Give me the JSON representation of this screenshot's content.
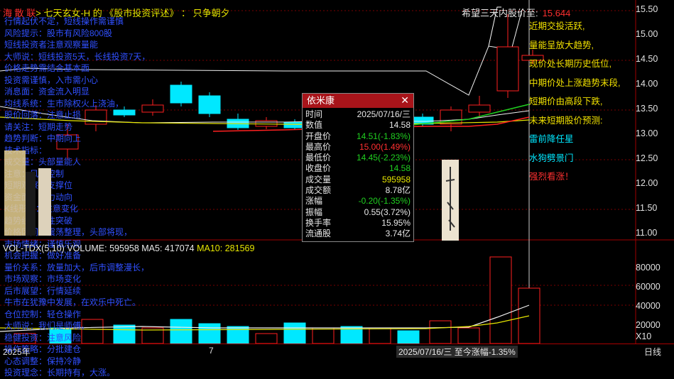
{
  "header": {
    "brand": "海 散 联",
    "text": "> 七天玄女-H  的 《股市投资评述》 ： 只争朝夕"
  },
  "forecast": {
    "label": "希望三天内股价至:",
    "value": "15.644"
  },
  "overlay_notes": [
    "行情起伏不定，短线操作需谨慎",
    "风险提示：股市有风险800股",
    "短线投资者注意观察量能",
    "大师说：短线投资5天，长线投资7天，",
    "价格走势需结合基本面",
    "投资需谨慎，入市需小心",
    "消息面：资金流入明显",
    "均线系统：生市除权火上浇油，",
    "股价回落：注意止损",
    "请关注：短期走势",
    "趋势判断：中期向上",
    "技术指标：",
    "成交量：头部量能人",
    "注意：风险控制",
    "短期观察：支撑位",
    "资金面：主力动向",
    "K线形态：注意变化",
    "趋势线：关注突破",
    "价格区间：震荡整理，头部将现，",
    "市场情绪：谨慎乐观",
    "机会把握：做好准备",
    "量价关系：放量加大，后市调整漫长，",
    "市场观察：市场变化",
    "后市展望：行情延续",
    "牛市在犹豫中发展，在欢乐中死亡。",
    "仓位控制：轻仓操作",
    "大师说：我们是师傅。",
    "稳健投资：注意风险",
    "操作策略：分批建仓",
    "心态调整：保持冷静",
    "投资理念：长期持有，大涨。"
  ],
  "commentary": [
    {
      "text": "近期交投活跃,",
      "color": "yellow"
    },
    {
      "text": "量能呈放大趋势,",
      "color": "yellow"
    },
    {
      "text": "现价处长期历史低位,",
      "color": "yellow"
    },
    {
      "text": "中期价处上涨趋势末段,",
      "color": "yellow"
    },
    {
      "text": "短期价由高段下跌,",
      "color": "yellow"
    },
    {
      "text": "未来短期股价预测:",
      "color": "yellow"
    },
    {
      "text": "雷前降任星",
      "color": "cyan"
    },
    {
      "text": "水狗劈景门",
      "color": "cyan"
    },
    {
      "text": "强烈看涨！",
      "color": "red"
    }
  ],
  "price_axis": [
    "15.50",
    "15.00",
    "14.50",
    "14.00",
    "13.50",
    "13.00",
    "12.50",
    "12.00",
    "11.50",
    "11.00"
  ],
  "volume": {
    "label": "VOL-TDX(5,10)",
    "volume_text": "VOLUME: 595958",
    "ma5_text": "MA5: 417074",
    "ma10_text": "MA10: 281569",
    "axis": [
      "80000",
      "60000",
      "40000",
      "20000"
    ],
    "unit": "X10"
  },
  "bottom_axis": {
    "start": "2025年",
    "mid": "7",
    "cursor": "2025/07/16/三  至今涨幅-1.35%",
    "period": "日线"
  },
  "popup": {
    "title": "依米康",
    "rows": [
      {
        "k": "时间",
        "v": "2025/07/16/三",
        "c": ""
      },
      {
        "k": "数值",
        "v": "14.58",
        "c": ""
      },
      {
        "k": "开盘价",
        "v": "14.51(-1.83%)",
        "c": "green"
      },
      {
        "k": "最高价",
        "v": "15.00(1.49%)",
        "c": "red"
      },
      {
        "k": "最低价",
        "v": "14.45(-2.23%)",
        "c": "green"
      },
      {
        "k": "收盘价",
        "v": "14.58",
        "c": "green"
      },
      {
        "k": "成交量",
        "v": "595958",
        "c": "yellow"
      },
      {
        "k": "成交额",
        "v": "8.78亿",
        "c": ""
      },
      {
        "k": "涨幅",
        "v": "-0.20(-1.35%)",
        "c": "green"
      },
      {
        "k": "振幅",
        "v": "0.55(3.72%)",
        "c": ""
      },
      {
        "k": "换手率",
        "v": "15.95%",
        "c": ""
      },
      {
        "k": "流通股",
        "v": "3.74亿",
        "c": ""
      }
    ]
  },
  "colors": {
    "up": "#ff2020",
    "down": "#00e8ff",
    "ma_yellow": "#e6e600",
    "ma_green": "#20d020",
    "ma_red": "#ff2020"
  }
}
